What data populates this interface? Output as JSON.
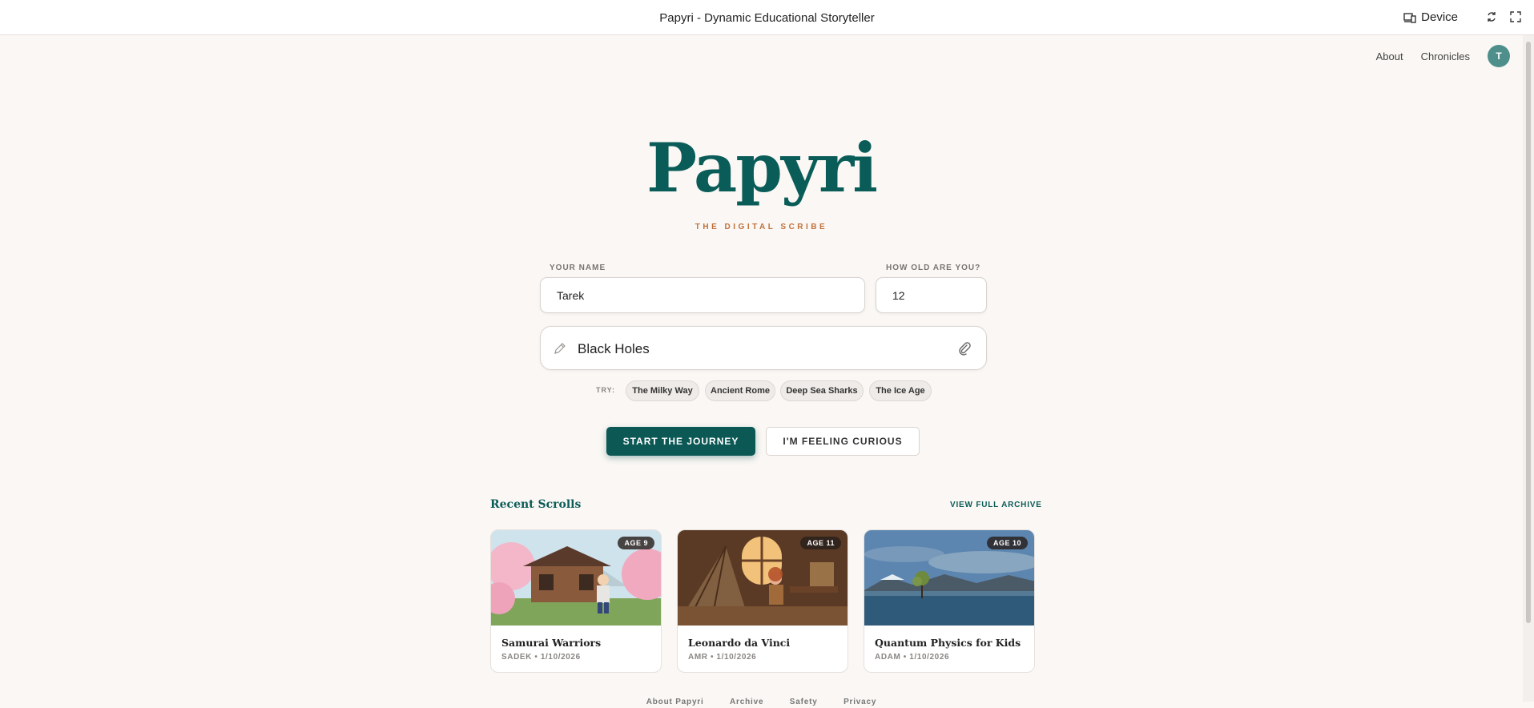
{
  "window": {
    "title": "Papyri - Dynamic Educational Storyteller",
    "device_label": "Device"
  },
  "nav": {
    "about": "About",
    "chronicles": "Chronicles",
    "avatar_initial": "T"
  },
  "hero": {
    "logo": "Papyri",
    "tagline": "THE DIGITAL SCRIBE"
  },
  "form": {
    "name_label": "YOUR NAME",
    "name_value": "Tarek",
    "age_label": "HOW OLD ARE YOU?",
    "age_value": "12",
    "topic_value": "Black Holes",
    "try_label": "TRY:",
    "suggestions": [
      "The Milky Way",
      "Ancient Rome",
      "Deep Sea Sharks",
      "The Ice Age"
    ],
    "start_button": "START THE JOURNEY",
    "curious_button": "I'M FEELING CURIOUS"
  },
  "recent": {
    "title": "Recent Scrolls",
    "view_all": "VIEW FULL ARCHIVE",
    "cards": [
      {
        "title": "Samurai Warriors",
        "meta": "SADEK • 1/10/2026",
        "age": "AGE 9",
        "image": "samurai-illustration"
      },
      {
        "title": "Leonardo da Vinci",
        "meta": "AMR • 1/10/2026",
        "age": "AGE 11",
        "image": "workshop-illustration"
      },
      {
        "title": "Quantum Physics for Kids",
        "meta": "ADAM • 1/10/2026",
        "age": "AGE 10",
        "image": "lake-photo"
      }
    ]
  },
  "footer": {
    "links": [
      "About Papyri",
      "Archive",
      "Safety",
      "Privacy"
    ]
  },
  "colors": {
    "brand": "#0a5c58",
    "accent": "#c0703a",
    "background": "#faf7f4"
  }
}
